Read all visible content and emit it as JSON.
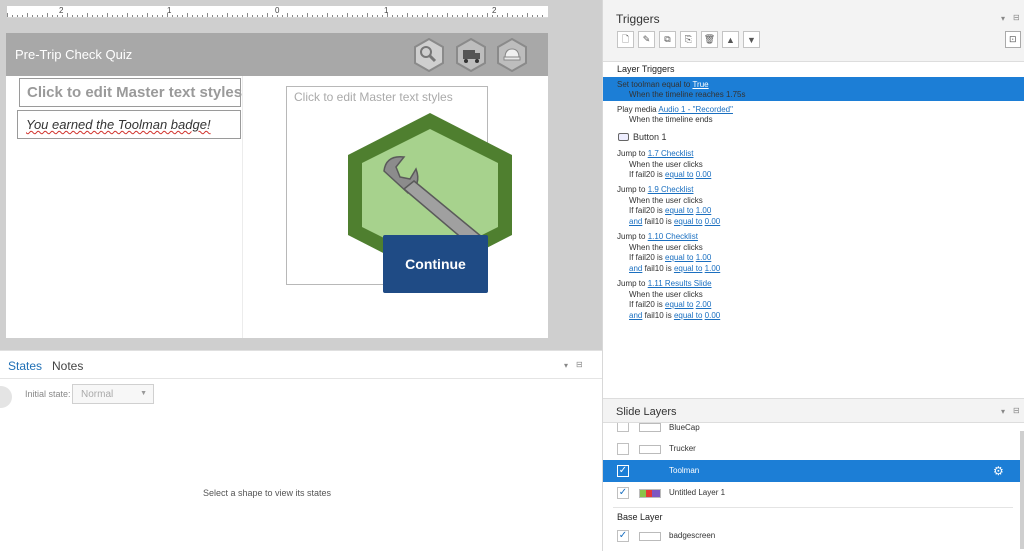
{
  "ruler": {
    "numbers": [
      "2",
      "1",
      "0",
      "1",
      "2"
    ]
  },
  "slide": {
    "title": "Pre-Trip Check Quiz",
    "placeholder_title": "Click to edit Master text styles",
    "badge_text": "You earned the Toolman badge!",
    "placeholder_right": "Click to edit Master text styles",
    "continue_label": "Continue",
    "header_icons": [
      "wrench-badge-icon",
      "truck-badge-icon",
      "cap-badge-icon"
    ]
  },
  "states_panel": {
    "tabs": [
      "States",
      "Notes"
    ],
    "initial_state_label": "Initial state:",
    "initial_state_value": "Normal",
    "empty_message": "Select a shape to view its states"
  },
  "triggers": {
    "title": "Triggers",
    "section_label": "Layer Triggers",
    "t1": {
      "pre": "Set toolman equal to ",
      "link": "True",
      "cond": "When the timeline reaches 1.75s"
    },
    "t2": {
      "pre": "Play media ",
      "link": "Audio 1 - \"Recorded\"",
      "cond": "When the timeline ends"
    },
    "button_group": "Button 1",
    "j1": {
      "pre": "Jump to ",
      "link": "1.7 Checklist",
      "when": "When the user clicks",
      "if_pre": "If fail20 is ",
      "op": "equal to",
      "val": "0.00"
    },
    "j2": {
      "pre": "Jump to ",
      "link": "1.9 Checklist",
      "when": "When the user clicks",
      "if_pre": "If fail20 is ",
      "op": "equal to",
      "val": "1.00",
      "and": "and",
      "and_mid": " fail10 is ",
      "op2": "equal to",
      "val2": "0.00"
    },
    "j3": {
      "pre": "Jump to ",
      "link": "1.10 Checklist",
      "when": "When the user clicks",
      "if_pre": "If fail20 is ",
      "op": "equal to",
      "val": "1.00",
      "and": "and",
      "and_mid": " fail10 is ",
      "op2": "equal to",
      "val2": "1.00"
    },
    "j4": {
      "pre": "Jump to ",
      "link": "1.11 Results Slide",
      "when": "When the user clicks",
      "if_pre": "If fail20 is ",
      "op": "equal to",
      "val": "2.00",
      "and": "and",
      "and_mid": " fail10 is ",
      "op2": "equal to",
      "val2": "0.00"
    }
  },
  "slide_layers": {
    "title": "Slide Layers",
    "layers": [
      {
        "name": "BlueCap",
        "checked": false
      },
      {
        "name": "Trucker",
        "checked": false
      },
      {
        "name": "Toolman",
        "checked": true,
        "selected": true
      },
      {
        "name": "Untitled Layer 1",
        "checked": true
      }
    ],
    "base_label": "Base Layer",
    "base_layer": {
      "name": "badgescreen",
      "checked": true
    }
  },
  "colors": {
    "accent": "#1c7ed6",
    "continue_button": "#1f4b85",
    "hex_outer": "#4f7f2f",
    "hex_inner": "#a7d28d"
  }
}
